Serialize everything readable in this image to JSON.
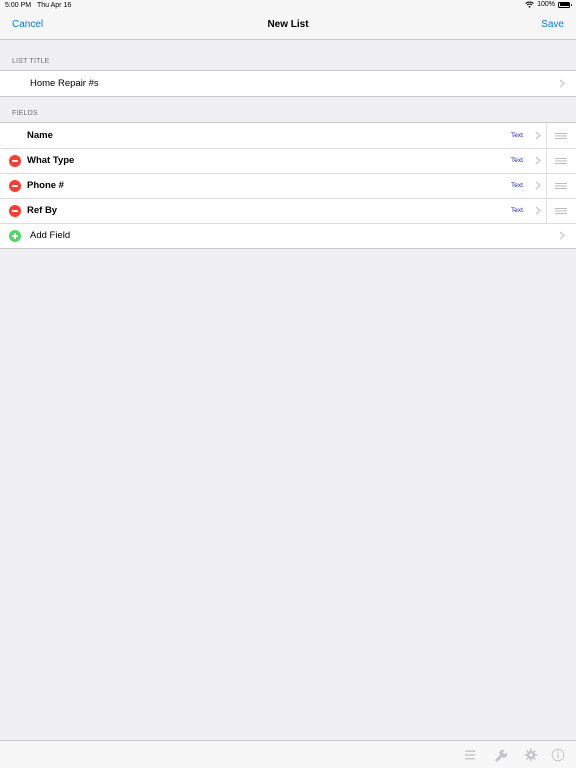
{
  "status_bar": {
    "time": "5:00 PM",
    "date": "Thu Apr 16",
    "battery": "100%"
  },
  "nav": {
    "cancel_label": "Cancel",
    "title": "New List",
    "save_label": "Save"
  },
  "list_title_section": {
    "header": "LIST TITLE",
    "value": "Home Repair #s"
  },
  "fields_section": {
    "header": "FIELDS",
    "fields": [
      {
        "name": "Name",
        "type": "Text",
        "deletable": false
      },
      {
        "name": "What Type",
        "type": "Text",
        "deletable": true
      },
      {
        "name": "Phone #",
        "type": "Text",
        "deletable": true
      },
      {
        "name": "Ref By",
        "type": "Text",
        "deletable": true
      }
    ],
    "add_field_label": "Add Field"
  },
  "toolbar": {
    "icons": [
      "list-icon",
      "wrench-icon",
      "gear-icon",
      "info-icon"
    ]
  },
  "colors": {
    "accent": "#007aff",
    "delete": "#ff3b30",
    "add": "#4cd964",
    "type_label": "#1a1ad6",
    "background": "#efeff4"
  }
}
